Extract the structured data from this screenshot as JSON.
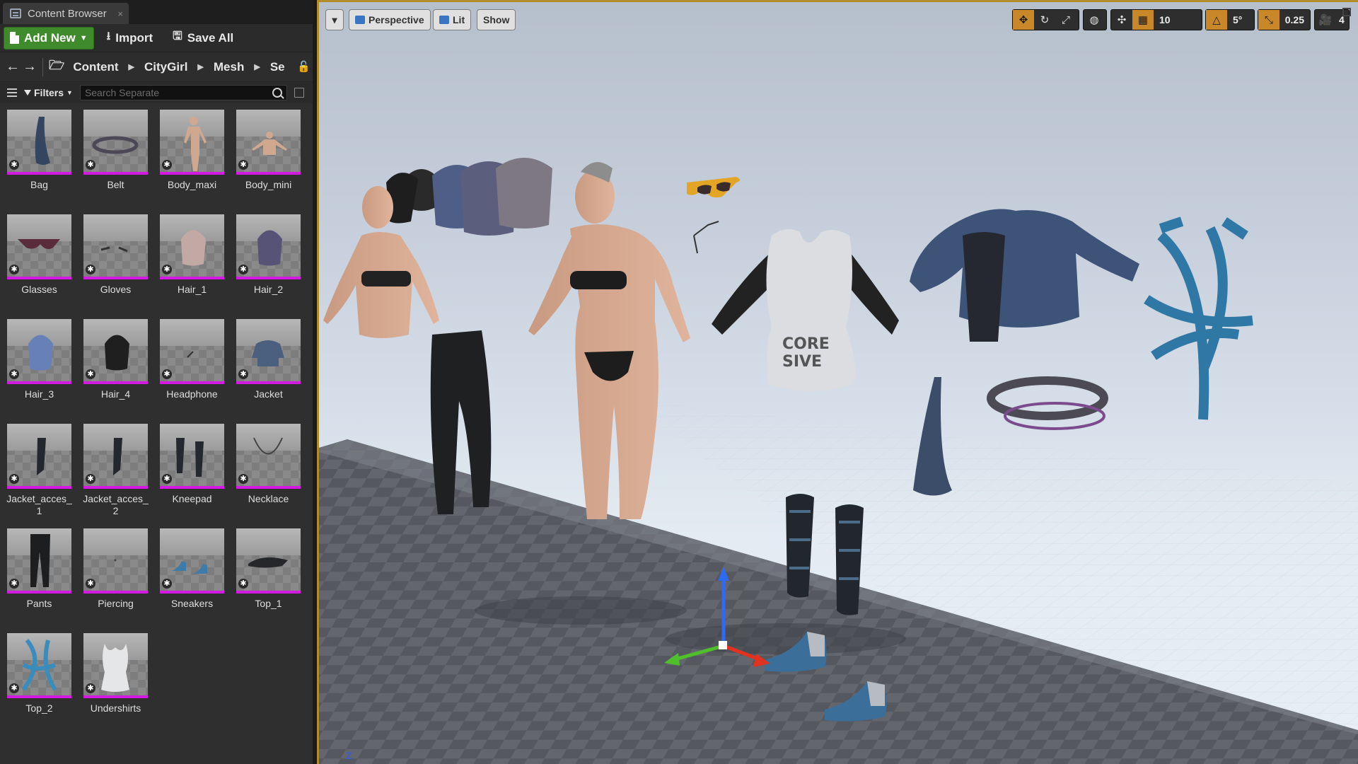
{
  "panel": {
    "tab_title": "Content Browser",
    "tab_close": "×",
    "toolbar": {
      "add_new": "Add New",
      "import": "Import",
      "save_all": "Save All"
    },
    "path": {
      "crumbs": [
        "Content",
        "CityGirl",
        "Mesh",
        "Se"
      ]
    },
    "filter": {
      "filters_label": "Filters",
      "search_placeholder": "Search Separate"
    },
    "assets": [
      {
        "label": "Bag",
        "icon": "bag"
      },
      {
        "label": "Belt",
        "icon": "belt"
      },
      {
        "label": "Body_maxi",
        "icon": "body"
      },
      {
        "label": "Body_mini",
        "icon": "body-small"
      },
      {
        "label": "Glasses",
        "icon": "glasses"
      },
      {
        "label": "Gloves",
        "icon": "gloves"
      },
      {
        "label": "Hair_1",
        "icon": "hair-light"
      },
      {
        "label": "Hair_2",
        "icon": "hair-purple"
      },
      {
        "label": "Hair_3",
        "icon": "hair-blue"
      },
      {
        "label": "Hair_4",
        "icon": "hair-dark"
      },
      {
        "label": "Headphone",
        "icon": "headphone"
      },
      {
        "label": "Jacket",
        "icon": "jacket"
      },
      {
        "label": "Jacket_acces_\n1",
        "icon": "jacket-acc"
      },
      {
        "label": "Jacket_acces_\n2",
        "icon": "jacket-acc"
      },
      {
        "label": "Kneepad",
        "icon": "kneepad"
      },
      {
        "label": "Necklace",
        "icon": "necklace"
      },
      {
        "label": "Pants",
        "icon": "pants"
      },
      {
        "label": "Piercing",
        "icon": "piercing"
      },
      {
        "label": "Sneakers",
        "icon": "sneakers"
      },
      {
        "label": "Top_1",
        "icon": "top"
      },
      {
        "label": "Top_2",
        "icon": "top-blue"
      },
      {
        "label": "Undershirts",
        "icon": "undershirt"
      }
    ]
  },
  "viewport": {
    "perspective": "Perspective",
    "lit": "Lit",
    "show": "Show",
    "grid_snap": "10",
    "rotation_snap": "5°",
    "scale_snap": "0.25",
    "camera_speed": "4",
    "axis_indicator": "Z",
    "colors": {
      "accent": "#c8882a",
      "asset_border": "#d21ae0",
      "add_new": "#3f8a2a"
    }
  }
}
